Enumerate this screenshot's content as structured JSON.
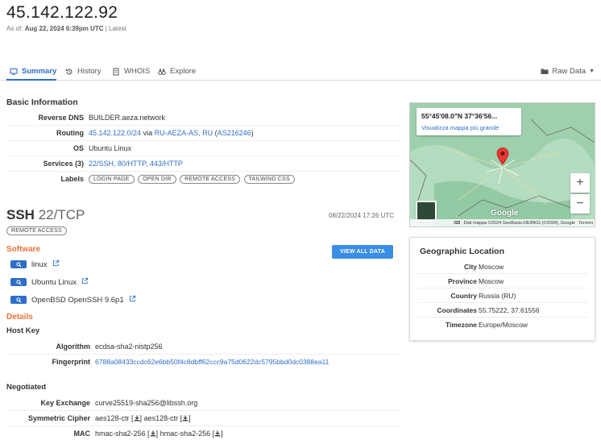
{
  "header": {
    "ip": "45.142.122.92",
    "as_of_label": "As of:",
    "as_of_date": "Aug 22, 2024 6:39pm UTC",
    "as_of_suffix": "| Latest"
  },
  "tabs": [
    {
      "label": "Summary",
      "icon": "monitor-icon",
      "active": true
    },
    {
      "label": "History",
      "icon": "history-icon",
      "active": false
    },
    {
      "label": "WHOIS",
      "icon": "document-icon",
      "active": false
    },
    {
      "label": "Explore",
      "icon": "binoculars-icon",
      "active": false
    }
  ],
  "raw_data_label": "Raw Data",
  "basic": {
    "title": "Basic Information",
    "reverse_dns_key": "Reverse DNS",
    "reverse_dns_val": "BUILDER.aeza.network",
    "routing_key": "Routing",
    "routing_prefix": "45.142.122.0/24",
    "routing_via": "via",
    "routing_org": "RU-AEZA-AS, RU",
    "routing_asn": "AS216246",
    "os_key": "OS",
    "os_val": "Ubuntu Linux",
    "services_key": "Services (3)",
    "services": [
      "22/SSH,",
      "80/HTTP,",
      "443/HTTP"
    ],
    "labels_key": "Labels",
    "labels": [
      "LOGIN PAGE",
      "OPEN DIR",
      "REMOTE ACCESS",
      "TAILWIND CSS"
    ]
  },
  "ssh": {
    "name": "SSH",
    "port": "22/TCP",
    "date": "08/22/2024 17:26 UTC",
    "tag": "REMOTE ACCESS",
    "software_title": "Software",
    "view_all": "VIEW ALL DATA",
    "software": [
      "linux",
      "Ubuntu Linux",
      "OpenBSD OpenSSH 9.6p1"
    ],
    "details_title": "Details",
    "host_key_title": "Host Key",
    "algorithm_key": "Algorithm",
    "algorithm_val": "ecdsa-sha2-nistp256",
    "fingerprint_key": "Fingerprint",
    "fingerprint_val": "6788a08433ccdc62e6bb50f4c8dbff62ccc9a75d0622dc5795bbd0dc0388ea11",
    "negotiated_title": "Negotiated",
    "kex_key": "Key Exchange",
    "kex_val": "curve25519-sha256@libssh.org",
    "cipher_key": "Symmetric Cipher",
    "cipher_a": "aes128-ctr",
    "cipher_b": "aes128-ctr",
    "mac_key": "MAC",
    "mac_a": "hmac-sha2-256",
    "mac_b": "hmac-sha2-256"
  },
  "map": {
    "coord": "55°45'08.0\"N 37°36'56...",
    "link": "Visualizza mappa più grande",
    "attribution": "Dati mappa ©2024 GeoBasis-DE/BKG (©2009), Google",
    "terms": "Termini",
    "google": "Google"
  },
  "geo": {
    "title": "Geographic Location",
    "rows": [
      {
        "key": "City",
        "val": "Moscow"
      },
      {
        "key": "Province",
        "val": "Moscow"
      },
      {
        "key": "Country",
        "val": "Russia (RU)"
      },
      {
        "key": "Coordinates",
        "val": "55.75222, 37.61556"
      },
      {
        "key": "Timezone",
        "val": "Europe/Moscow"
      }
    ]
  },
  "colors": {
    "accent": "#2e6ec8",
    "orange": "#e8743b",
    "button": "#3a8ee6"
  }
}
